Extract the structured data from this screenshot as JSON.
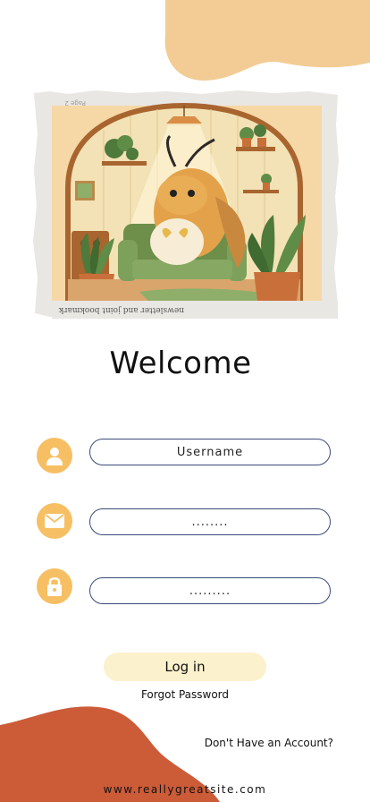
{
  "header": {
    "title": "Welcome"
  },
  "form": {
    "username": {
      "placeholder": "Username",
      "icon": "user-icon"
    },
    "email": {
      "value": "........",
      "icon": "envelope-icon"
    },
    "password": {
      "value": ".........",
      "icon": "lock-icon"
    }
  },
  "actions": {
    "login_label": "Log in",
    "forgot_label": "Forgot Password",
    "signup_label": "Don't Have an Account?"
  },
  "footer": {
    "website": "www.reallygreatsite.com"
  },
  "hero": {
    "page_label": "Page 2",
    "caption": "newsletter and joint bookmark"
  },
  "colors": {
    "accent_icon": "#f7bf63",
    "top_blob": "#f2cc94",
    "bottom_blob": "#cc5b38",
    "button_bg": "#fbf1cc",
    "field_border": "#3b4a7a"
  }
}
